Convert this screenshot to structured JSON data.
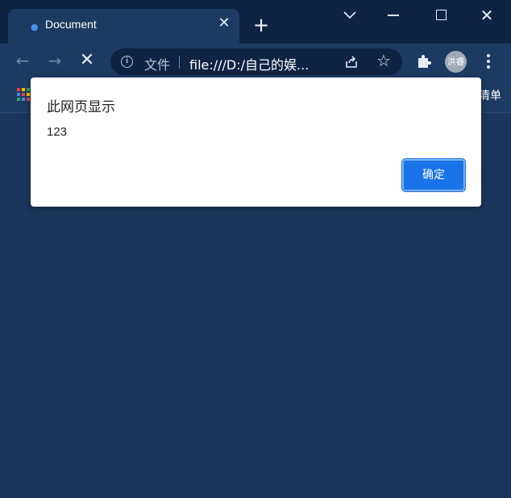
{
  "tab": {
    "title": "Document"
  },
  "toolbar": {
    "file_label": "文件",
    "url": "file:///D:/自己的娱..."
  },
  "profile": {
    "avatar_text": "洪睿"
  },
  "bookmarks": {
    "edge_text": "清单"
  },
  "dialog": {
    "title": "此网页显示",
    "message": "123",
    "ok_label": "确定"
  },
  "colors": {
    "page_bg": "#1b355c",
    "accent": "#1a73e8",
    "apps_grid": [
      "#ea4335",
      "#fbbc04",
      "#34a853",
      "#4285f4",
      "#ea4335",
      "#fbbc04",
      "#34a853",
      "#4285f4",
      "#ea4335"
    ]
  },
  "icons": {
    "favicon": "loading-dot-icon",
    "tab_close": "close-icon",
    "new_tab": "plus-icon",
    "tab_search": "chevron-down-icon",
    "back": "arrow-left-icon",
    "forward": "arrow-right-icon",
    "stop": "close-icon",
    "info": "info-icon",
    "share": "share-icon",
    "bookmark": "star-icon",
    "extensions": "puzzle-icon",
    "menu": "kebab-menu-icon",
    "apps": "apps-grid-icon"
  }
}
